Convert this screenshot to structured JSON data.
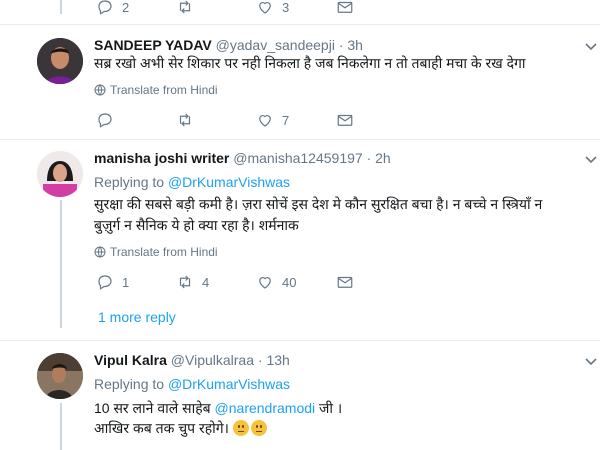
{
  "tweets": [
    {
      "actions": {
        "reply": "2",
        "retweet": "",
        "like": "3"
      }
    },
    {
      "name": "SANDEEP YADAV",
      "handle": "@yadav_sandeepji",
      "time": "· 3h",
      "text": "सब्र रखो अभी सेर शिकार पर नही निकला है जब निकलेगा न तो तबाही मचा के रख देगा",
      "translate": "Translate from Hindi",
      "actions": {
        "reply": "",
        "retweet": "",
        "like": "7"
      }
    },
    {
      "name": "manisha joshi writer",
      "handle": "@manisha12459197",
      "time": "· 2h",
      "replying_prefix": "Replying to",
      "replying_to": "@DrKumarVishwas",
      "text_line1": "सुरक्षा की सबसे बड़ी कमी है।  ज़रा सोचें इस देश मे कौन सुरक्षित बचा है। न बच्चे न स्त्रियाँ न",
      "text_line2": "बुज़ुर्ग न सैनिक ये हो क्या रहा है। शर्मनाक",
      "translate": "Translate from Hindi",
      "actions": {
        "reply": "1",
        "retweet": "4",
        "like": "40"
      },
      "more_replies": "1 more reply"
    },
    {
      "name": "Vipul Kalra",
      "handle": "@Vipulkalraa",
      "time": "· 13h",
      "replying_prefix": "Replying to",
      "replying_to": "@DrKumarVishwas",
      "text_line1_a": "10 सर लाने वाले साहेब ",
      "text_line1_mention": "@narendramodi",
      "text_line1_b": " जी ।",
      "text_line2": "आखिर कब तक चुप रहोगे। "
    }
  ],
  "colors": {
    "link": "#1da1f2",
    "muted": "#657786",
    "divider": "#e6ecf0"
  }
}
